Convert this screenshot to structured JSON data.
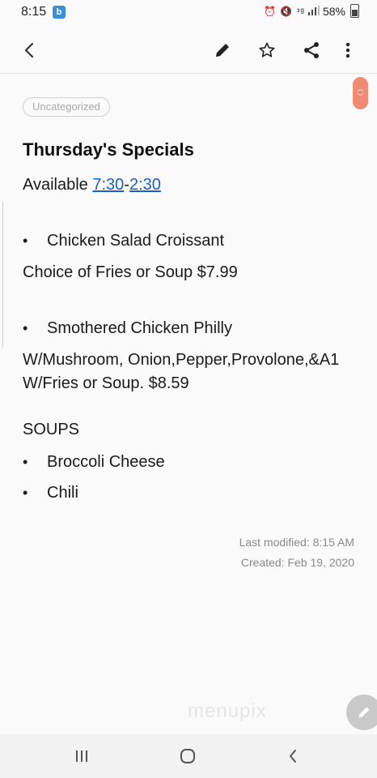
{
  "status_bar": {
    "time": "8:15",
    "notif_glyph": "b",
    "right_glyphs": "⏰ 🔇 ᵌᵍ",
    "battery": "58%"
  },
  "app_bar": {
    "icons": [
      "back-icon",
      "pencil-icon",
      "star-icon",
      "share-icon",
      "more-icon"
    ]
  },
  "note": {
    "category": "Uncategorized",
    "title": "Thursday's Specials",
    "available_prefix": "Available ",
    "time_start": "7:30",
    "time_sep": "-",
    "time_end": "2:30",
    "item1": "Chicken Salad Croissant",
    "item1_detail": "Choice of Fries or Soup $7.99",
    "item2": "Smothered Chicken Philly",
    "item2_detail1": "W/Mushroom, Onion,Pepper,Provolone,&A1",
    "item2_detail2": "W/Fries or Soup. $8.59",
    "soups_heading": "SOUPS",
    "soup1": "Broccoli Cheese",
    "soup2": "Chili",
    "bullet": "•"
  },
  "meta": {
    "last_modified": "Last modified: 8:15 AM",
    "created": "Created: Feb 19, 2020"
  },
  "watermark": "menupix",
  "colors": {
    "scroll_handle": "#f08a74",
    "link": "#1f5fbf"
  }
}
